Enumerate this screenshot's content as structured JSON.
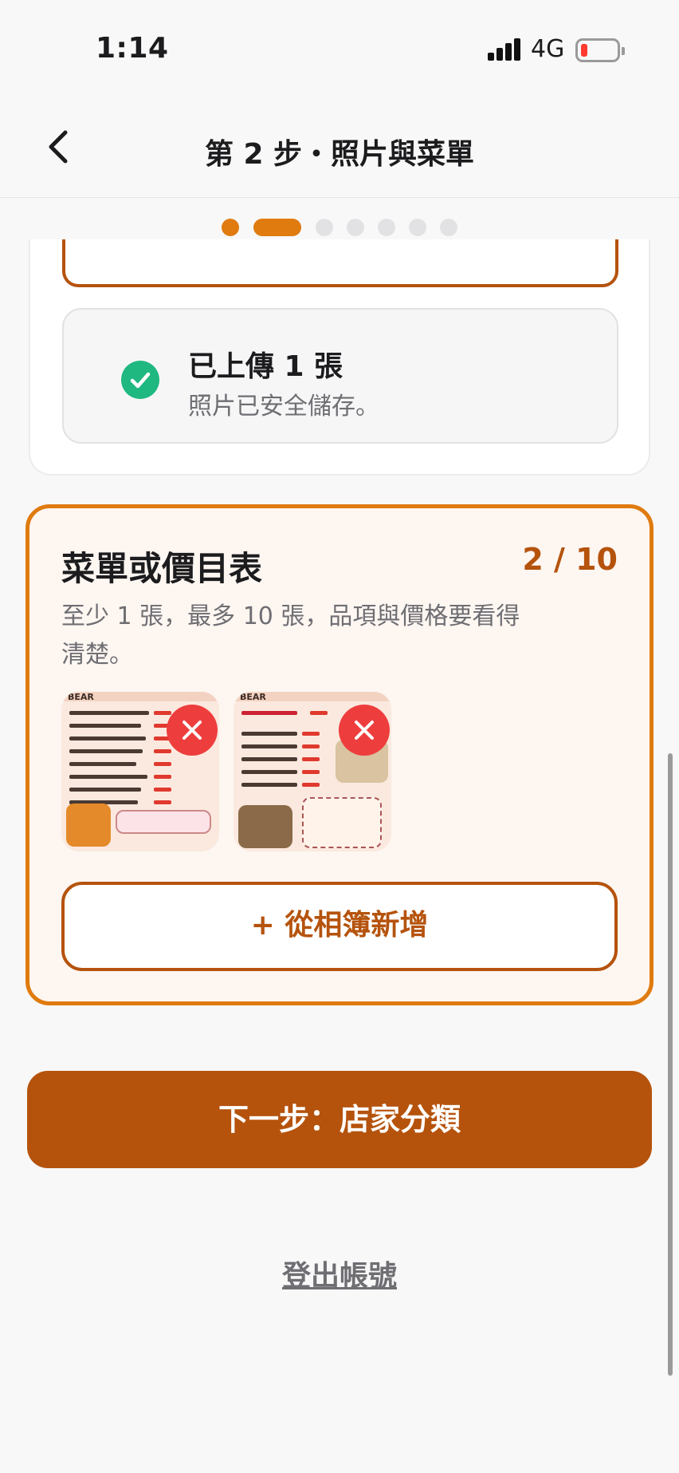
{
  "status_bar": {
    "time": "1:14",
    "network": "4G",
    "battery_level": 0.1
  },
  "nav": {
    "title": "第 2 步・照片與菜單",
    "back_icon": "chevron-left-icon"
  },
  "progress": {
    "total_steps": 7,
    "current_step": 2,
    "colors": {
      "done": "#e07b10",
      "pending": "#e2e2e4"
    }
  },
  "photos": {
    "uploaded_title": "已上傳 1 張",
    "uploaded_sub": "照片已安全儲存。",
    "status_icon": "check-circle-icon",
    "status_color": "#1fb880"
  },
  "menu": {
    "title": "菜單或價目表",
    "count": "2 / 10",
    "description": "至少 1 張，最多 10 張，品項與價格要看得清楚。",
    "thumbnails": [
      {
        "label": "BEAR",
        "remove_icon": "close-icon"
      },
      {
        "label": "BEAR",
        "remove_icon": "close-icon"
      }
    ],
    "add_button": "+ 從相簿新增"
  },
  "next_button": "下一步：店家分類",
  "logout_link": "登出帳號",
  "colors": {
    "brand": "#b5530d",
    "accent": "#e07b10",
    "danger": "#ee3d3d",
    "success": "#1fb880"
  }
}
